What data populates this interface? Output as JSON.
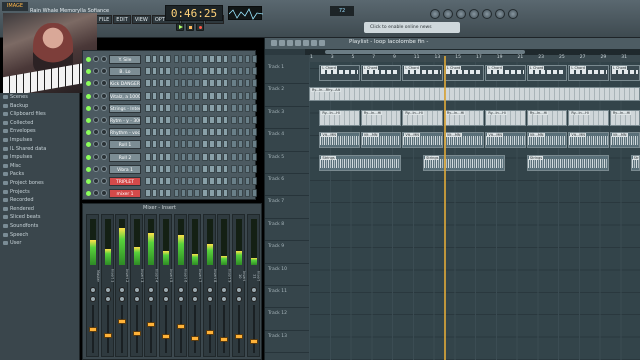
{
  "toolbar": {
    "app_logo": "IMAGE",
    "song_title": "Rain Whale Memorylla Sofiance",
    "bpm_time": "0:46:25",
    "menus": [
      "FILE",
      "EDIT",
      "VIEW",
      "OPTIONS",
      "TOOLS",
      "HELP"
    ],
    "cpu": "72",
    "hint": "Click to enable online news"
  },
  "browser": {
    "items": [
      "Scenes",
      "Backup",
      "Clipboard files",
      "Collected",
      "Envelopes",
      "Impulses",
      "IL Shared data",
      "Impulses",
      "Misc",
      "Packs",
      "Project bones",
      "Projects",
      "Recorded",
      "Rendered",
      "Sliced beats",
      "Soundfonts",
      "Speech",
      "User"
    ]
  },
  "sequencer": {
    "channels": [
      {
        "name": "Y. Sile",
        "red": false,
        "steps": [
          0,
          0,
          0,
          0,
          0,
          0,
          0,
          0,
          0,
          0,
          0,
          0,
          0,
          0,
          0,
          0
        ]
      },
      {
        "name": "B. Lo",
        "red": false,
        "steps": [
          0,
          0,
          0,
          0,
          0,
          0,
          0,
          0,
          0,
          0,
          0,
          0,
          0,
          0,
          0,
          0
        ]
      },
      {
        "name": "Kick DANGER",
        "red": false,
        "steps": [
          0,
          0,
          0,
          0,
          0,
          0,
          0,
          0,
          0,
          0,
          0,
          0,
          0,
          0,
          0,
          0
        ]
      },
      {
        "name": "Vitalz, a 1000",
        "red": false,
        "steps": [
          0,
          0,
          0,
          0,
          0,
          0,
          0,
          0,
          0,
          0,
          0,
          0,
          0,
          0,
          0,
          0
        ]
      },
      {
        "name": "Strings - Interlu",
        "red": false,
        "steps": [
          0,
          0,
          0,
          0,
          0,
          0,
          0,
          0,
          0,
          0,
          0,
          0,
          0,
          0,
          0,
          0
        ]
      },
      {
        "name": "Rytm - y - 3062",
        "red": false,
        "steps": [
          0,
          0,
          0,
          0,
          0,
          0,
          0,
          0,
          0,
          0,
          0,
          0,
          0,
          0,
          0,
          0
        ]
      },
      {
        "name": "Rhythm - vocal",
        "red": false,
        "steps": [
          0,
          0,
          0,
          0,
          0,
          0,
          0,
          0,
          0,
          0,
          0,
          0,
          0,
          0,
          0,
          0
        ]
      },
      {
        "name": "Roll 1",
        "red": false,
        "steps": [
          0,
          0,
          0,
          0,
          0,
          0,
          0,
          0,
          0,
          0,
          0,
          0,
          0,
          0,
          0,
          0
        ]
      },
      {
        "name": "Roll 2",
        "red": false,
        "steps": [
          0,
          0,
          0,
          0,
          0,
          0,
          0,
          0,
          0,
          0,
          0,
          0,
          0,
          0,
          0,
          0
        ]
      },
      {
        "name": "Vibra 1",
        "red": false,
        "steps": [
          0,
          0,
          0,
          0,
          0,
          0,
          0,
          0,
          0,
          0,
          0,
          0,
          0,
          0,
          0,
          0
        ]
      },
      {
        "name": "TRIPLET",
        "red": true,
        "steps": [
          0,
          0,
          0,
          0,
          0,
          0,
          0,
          0,
          0,
          0,
          0,
          0,
          0,
          0,
          0,
          0
        ]
      },
      {
        "name": "mixer 1",
        "red": true,
        "steps": [
          0,
          0,
          0,
          0,
          0,
          0,
          0,
          0,
          0,
          0,
          0,
          0,
          0,
          0,
          0,
          0
        ]
      }
    ]
  },
  "mixer": {
    "title": "Mixer - Insert",
    "strips": [
      {
        "label": "Master",
        "level": 0.55
      },
      {
        "label": "Insert 1",
        "level": 0.35
      },
      {
        "label": "Insert 2",
        "level": 0.8
      },
      {
        "label": "Insert 3",
        "level": 0.4
      },
      {
        "label": "Insert 4",
        "level": 0.7
      },
      {
        "label": "Insert 5",
        "level": 0.3
      },
      {
        "label": "Insert 6",
        "level": 0.65
      },
      {
        "label": "Insert 7",
        "level": 0.25
      },
      {
        "label": "Insert 8",
        "level": 0.45
      },
      {
        "label": "Insert 9",
        "level": 0.2
      },
      {
        "label": "Insert 10",
        "level": 0.3
      },
      {
        "label": "Insert 11",
        "level": 0.15
      }
    ]
  },
  "playlist": {
    "title": "Playlist - loop lacolombe fin -",
    "bars": [
      "1",
      "3",
      "5",
      "7",
      "9",
      "11",
      "13",
      "15",
      "17",
      "19",
      "21",
      "23",
      "25",
      "27",
      "29",
      "31"
    ],
    "tracks": [
      "Track 1",
      "Track 2",
      "Track 3",
      "Track 4",
      "Track 5",
      "Track 6",
      "Track 7",
      "Track 8",
      "Track 9",
      "Track 10",
      "Track 11",
      "Track 12",
      "Track 13"
    ],
    "clips": [
      {
        "label": "L Chord",
        "kind": "notes",
        "track": 0,
        "start": 1,
        "length": 4
      },
      {
        "label": "L Chord",
        "kind": "notes",
        "track": 0,
        "start": 5,
        "length": 4
      },
      {
        "label": "L Chord",
        "kind": "notes",
        "track": 0,
        "start": 9,
        "length": 4
      },
      {
        "label": "L Chord",
        "kind": "notes",
        "track": 0,
        "start": 13,
        "length": 4
      },
      {
        "label": "L Chord",
        "kind": "notes",
        "track": 0,
        "start": 17,
        "length": 4
      },
      {
        "label": "L Chord",
        "kind": "notes",
        "track": 0,
        "start": 21,
        "length": 4
      },
      {
        "label": "L Chord",
        "kind": "notes",
        "track": 0,
        "start": 25,
        "length": 4
      },
      {
        "label": "L Chord",
        "kind": "notes",
        "track": 0,
        "start": 29,
        "length": 3
      },
      {
        "label": "Ry...In...Rhy...Alt",
        "kind": "pattern",
        "track": 1,
        "start": 0,
        "length": 32
      },
      {
        "label": "Ry...In...Hi",
        "kind": "pattern",
        "track": 2,
        "start": 1,
        "length": 4
      },
      {
        "label": "Ry...In...Hi",
        "kind": "pattern",
        "track": 2,
        "start": 5,
        "length": 4
      },
      {
        "label": "Ry...In...Hi",
        "kind": "pattern",
        "track": 2,
        "start": 9,
        "length": 4
      },
      {
        "label": "Ry...In...Hi",
        "kind": "pattern",
        "track": 2,
        "start": 13,
        "length": 4
      },
      {
        "label": "Ry...In...Hi",
        "kind": "pattern",
        "track": 2,
        "start": 17,
        "length": 4
      },
      {
        "label": "Ry...In...Hi",
        "kind": "pattern",
        "track": 2,
        "start": 21,
        "length": 4
      },
      {
        "label": "Ry...In...Hi",
        "kind": "pattern",
        "track": 2,
        "start": 25,
        "length": 4
      },
      {
        "label": "Ry...In...Hi",
        "kind": "pattern",
        "track": 2,
        "start": 29,
        "length": 3
      },
      {
        "label": "Vit...MN",
        "kind": "audio",
        "track": 3,
        "start": 1,
        "length": 4
      },
      {
        "label": "Vit...MN",
        "kind": "audio",
        "track": 3,
        "start": 5,
        "length": 4
      },
      {
        "label": "Vit...MN",
        "kind": "audio",
        "track": 3,
        "start": 9,
        "length": 4
      },
      {
        "label": "Vit...MN",
        "kind": "audio",
        "track": 3,
        "start": 13,
        "length": 4
      },
      {
        "label": "Vit...MN",
        "kind": "audio",
        "track": 3,
        "start": 17,
        "length": 4
      },
      {
        "label": "Vit...MN",
        "kind": "audio",
        "track": 3,
        "start": 21,
        "length": 4
      },
      {
        "label": "Vit...MN",
        "kind": "audio",
        "track": 3,
        "start": 25,
        "length": 4
      },
      {
        "label": "Vit...MN",
        "kind": "audio",
        "track": 3,
        "start": 29,
        "length": 3
      },
      {
        "label": "Strings",
        "kind": "audio",
        "track": 4,
        "start": 1,
        "length": 8
      },
      {
        "label": "Strings",
        "kind": "audio",
        "track": 4,
        "start": 11,
        "length": 8
      },
      {
        "label": "Strings",
        "kind": "audio",
        "track": 4,
        "start": 21,
        "length": 8
      },
      {
        "label": "Strings",
        "kind": "audio",
        "track": 4,
        "start": 31,
        "length": 1
      }
    ],
    "playhead_bar": 13
  }
}
